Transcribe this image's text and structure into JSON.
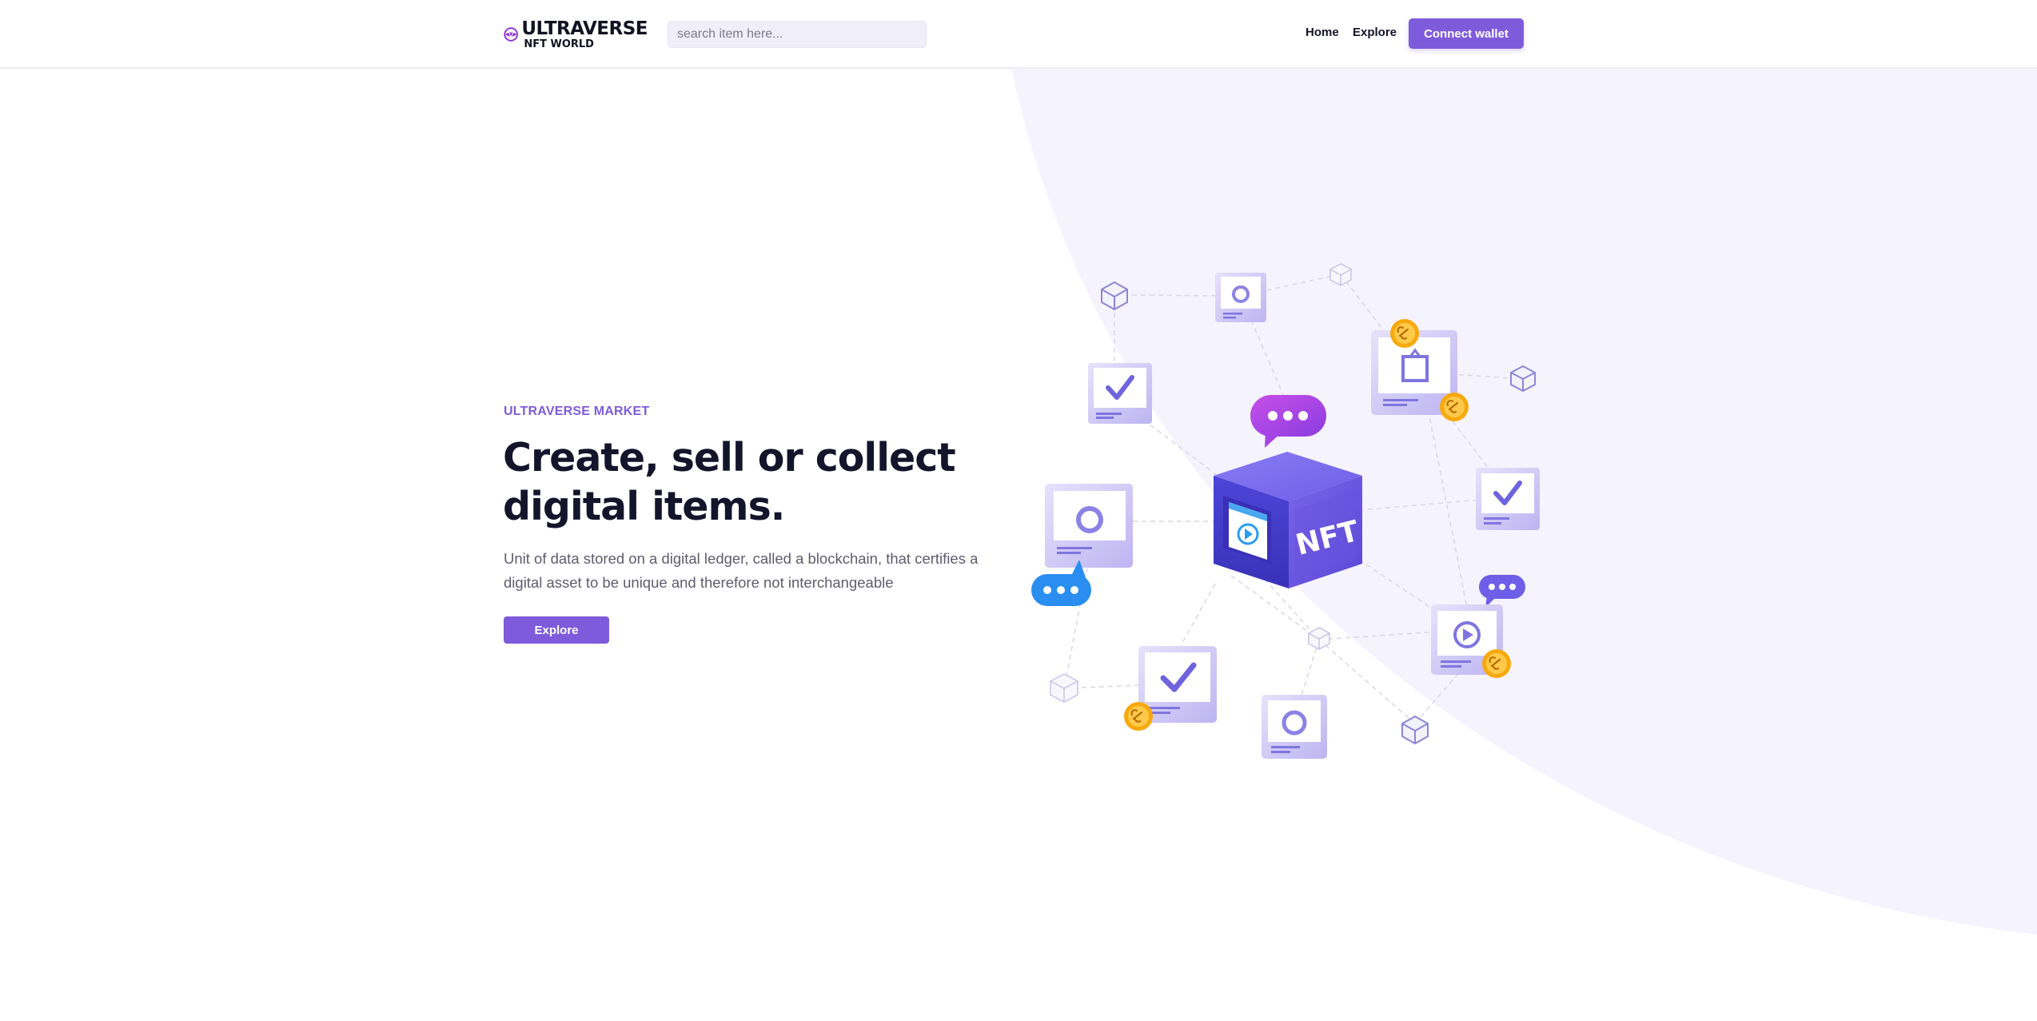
{
  "header": {
    "logo_title": "ULTRAVERSE",
    "logo_subtitle": "NFT WORLD",
    "search_placeholder": "search item here...",
    "nav": {
      "home": "Home",
      "explore": "Explore"
    },
    "connect_label": "Connect wallet"
  },
  "hero": {
    "eyebrow": "ULTRAVERSE MARKET",
    "headline": "Create, sell or collect digital items.",
    "description": "Unit of data stored on a digital ledger, called a blockchain, that certifies a digital asset to be unique and therefore not interchangeable",
    "explore_label": "Explore"
  },
  "illustration": {
    "cube_label": "NFT",
    "icons": [
      "nft-cube-icon",
      "check-card-icon",
      "circle-card-icon",
      "play-card-icon",
      "frame-card-icon",
      "chat-bubble-icon",
      "chain-link-coin-icon",
      "wireframe-cube-icon"
    ]
  },
  "colors": {
    "accent": "#7e5bdb",
    "background_arc": "#f5f3fd",
    "heading": "#14142b",
    "body_text": "#5d5d6d",
    "coin": "#f7a90c",
    "chat_blue": "#2a8ef0",
    "chat_magenta": "#b43fe6"
  }
}
